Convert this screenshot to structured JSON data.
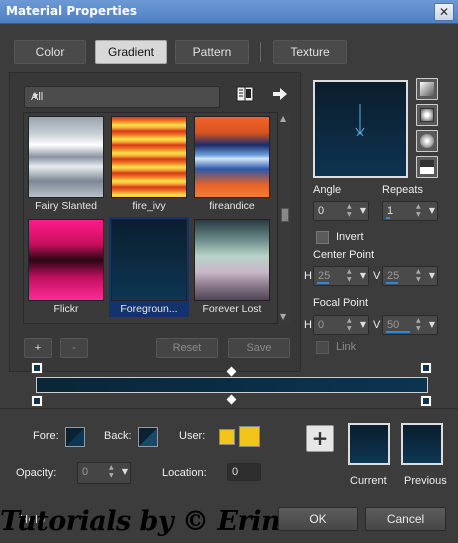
{
  "window": {
    "title": "Material Properties",
    "close": "✕"
  },
  "tabs": [
    {
      "label": "Color"
    },
    {
      "label": "Gradient"
    },
    {
      "label": "Pattern"
    },
    {
      "label": "Texture"
    }
  ],
  "category": {
    "value": "All"
  },
  "thumbnails": [
    {
      "label": "Fairy Slanted"
    },
    {
      "label": "fire_ivy"
    },
    {
      "label": "fireandice"
    },
    {
      "label": "Flickr"
    },
    {
      "label": "Foregroun...",
      "selected": true
    },
    {
      "label": "Forever Lost"
    }
  ],
  "buttons": {
    "add": "+",
    "remove": "-",
    "reset": "Reset",
    "save": "Save"
  },
  "angle": {
    "label": "Angle",
    "value": "0"
  },
  "repeats": {
    "label": "Repeats",
    "value": "1"
  },
  "invert": {
    "label": "Invert",
    "checked": false
  },
  "center_point": {
    "label": "Center Point",
    "h_label": "H",
    "h": "25",
    "v_label": "V",
    "v": "25"
  },
  "focal_point": {
    "label": "Focal Point",
    "h_label": "H",
    "h": "0",
    "v_label": "V",
    "v": "50"
  },
  "link": {
    "label": "Link",
    "checked": false
  },
  "colors": {
    "fore_label": "Fore:",
    "back_label": "Back:",
    "user_label": "User:",
    "current_label": "Current",
    "previous_label": "Previous",
    "gradient_start": "#0a2638",
    "gradient_end": "#0b3451",
    "user_color": "#f2c318"
  },
  "opacity": {
    "label": "Opacity:",
    "value": "0"
  },
  "location": {
    "label": "Location:",
    "value": "0"
  },
  "footer": {
    "help": "Help",
    "ok": "OK",
    "cancel": "Cancel"
  },
  "watermark": "Tutorials by © Erina"
}
